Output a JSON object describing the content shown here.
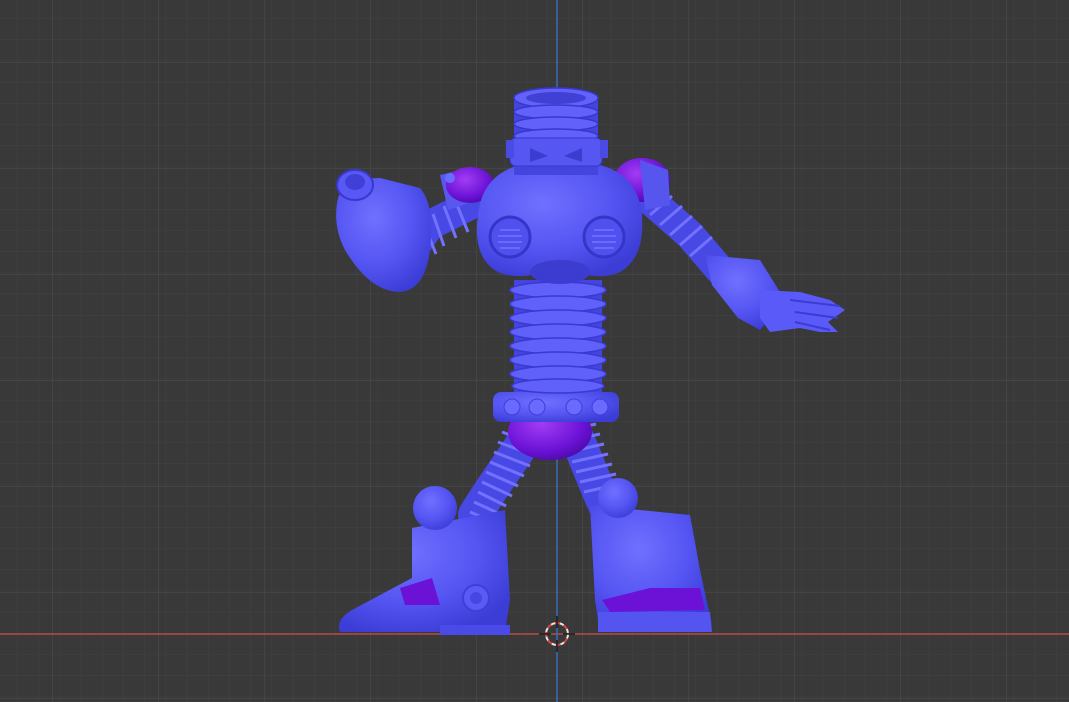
{
  "viewport": {
    "kind": "3d-viewport",
    "view": "front-orthographic",
    "background_color": "#393939",
    "grid_minor_color": "#414141",
    "grid_major_color": "#4a4a4a",
    "x_axis_color": "#c0504d",
    "z_axis_color": "#3a6fc4",
    "cursor_icon": "3d-cursor-icon"
  },
  "model": {
    "subject": "robot-figure",
    "mesh_color": "#5353f3",
    "mesh_shadow_color": "#3a3ad8",
    "mesh_highlight_color": "#7474ff",
    "accent_color": "#6b12d6",
    "accent_highlight_color": "#9b3cf0"
  }
}
